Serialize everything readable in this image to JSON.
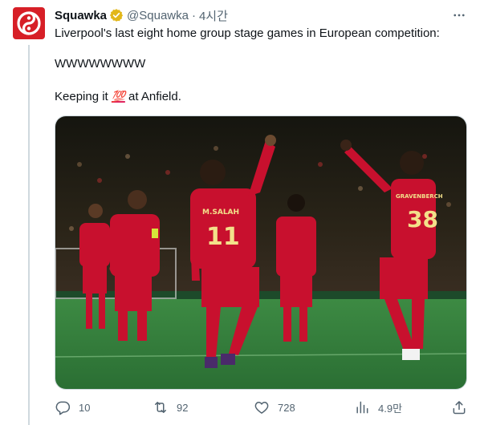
{
  "author": {
    "display_name": "Squawka",
    "handle": "@Squawka",
    "separator": "·",
    "time": "4시간"
  },
  "tweet": {
    "line1": "Liverpool's last eight home group stage games in European competition:",
    "line2": "WWWWWWWW",
    "line3_before": "Keeping it ",
    "line3_emoji": "💯",
    "line3_after": " at Anfield."
  },
  "media": {
    "players": [
      {
        "shirt_name": "M.SALAH",
        "number": "11"
      },
      {
        "shirt_name": "GRAVENBERCH",
        "number": "38"
      }
    ]
  },
  "actions": {
    "replies": "10",
    "reposts": "92",
    "likes": "728",
    "views": "4.9만"
  },
  "colors": {
    "brand_red": "#d71f27",
    "verified_gold": "#e2b719",
    "text_primary": "#0f1419",
    "text_secondary": "#536471",
    "kit_red": "#c8102e",
    "pitch_green": "#2f7d3a"
  },
  "icons": [
    "more-icon",
    "verified-badge-icon",
    "reply-icon",
    "repost-icon",
    "like-icon",
    "views-icon",
    "share-icon"
  ]
}
